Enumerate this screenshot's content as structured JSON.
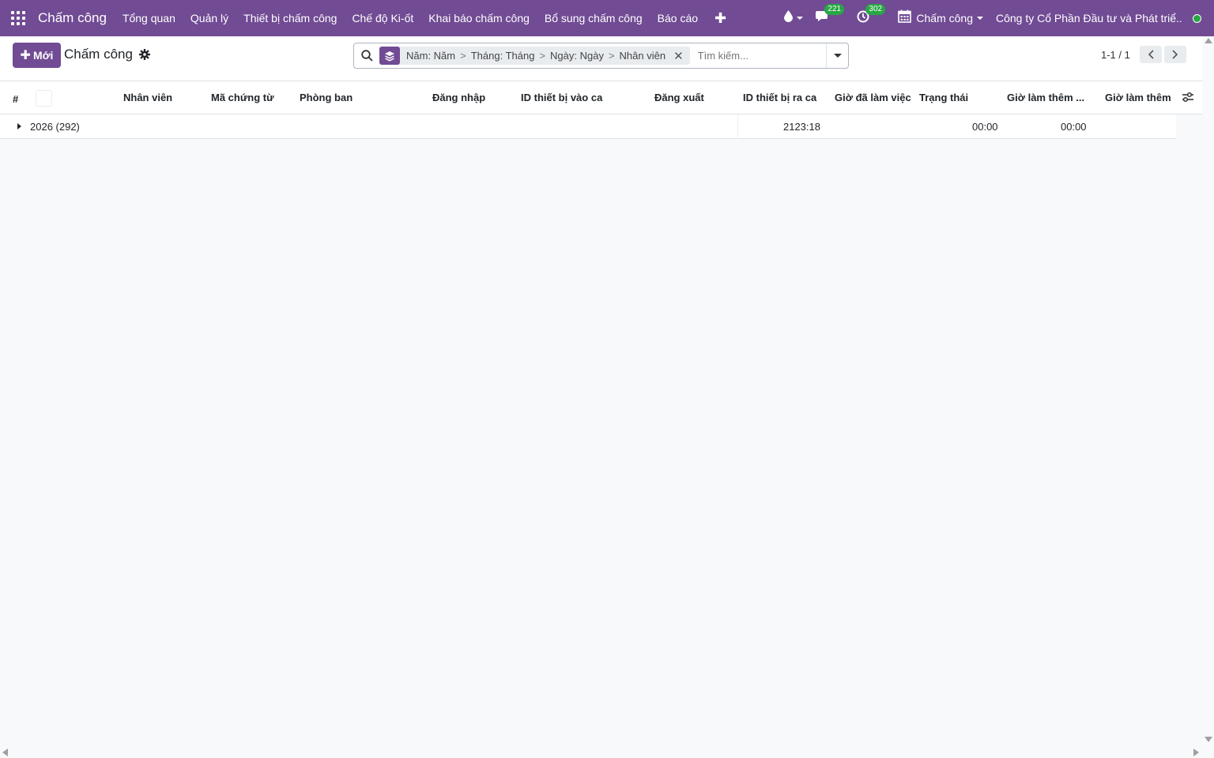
{
  "navbar": {
    "brand": "Chấm công",
    "menu": [
      "Tổng quan",
      "Quản lý",
      "Thiết bị chấm công",
      "Chế độ Ki-ốt",
      "Khai báo chấm công",
      "Bổ sung chấm công",
      "Báo cáo"
    ],
    "add_menu": "✚",
    "messages_count": "221",
    "activities_count": "302",
    "app_switcher_label": "Chấm công",
    "company": "Công ty Cổ Phần Đầu tư và Phát triể...",
    "accent_color": "#714b94",
    "status_color": "#28a745"
  },
  "control_panel": {
    "new_button": "Mới",
    "breadcrumb": "Chấm công",
    "search": {
      "facets": [
        "Năm: Năm",
        "Tháng: Tháng",
        "Ngày: Ngày",
        "Nhân viên"
      ],
      "separator": ">",
      "placeholder": "Tìm kiếm..."
    },
    "pager": "1-1 / 1"
  },
  "table": {
    "columns": [
      "#",
      "Nhân viên",
      "Mã chứng từ",
      "Phòng ban",
      "Đăng nhập",
      "ID thiết bị vào ca",
      "Đăng xuất",
      "ID thiết bị ra ca",
      "Giờ đã làm việc",
      "Trạng thái",
      "Giờ làm thêm ...",
      "Giờ làm thêm"
    ],
    "groups": [
      {
        "label": "2026 (292)",
        "worked_hours": "2123:18",
        "overtime_1": "00:00",
        "overtime_2": "00:00"
      }
    ]
  }
}
